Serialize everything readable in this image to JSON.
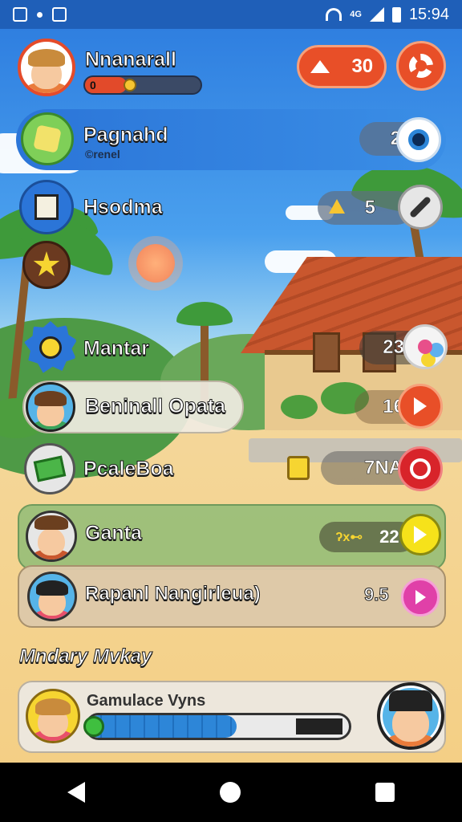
{
  "status_bar": {
    "time": "15:94",
    "network": "4G"
  },
  "player": {
    "name": "Nnanarall",
    "level_text": "0",
    "xp_fraction": 0.36
  },
  "coins": {
    "value": "30"
  },
  "rows": [
    {
      "label": "Pagnahd",
      "sub": "©renel",
      "value": "2"
    },
    {
      "label": "Hsodma",
      "value": "5"
    },
    {
      "label": "Mantar",
      "value": "23"
    },
    {
      "label": "Beninall Opata",
      "value": "16"
    },
    {
      "label": "PcaleBoa",
      "value": "7NA"
    },
    {
      "label": "Ganta",
      "value": "22",
      "prefix": "ʔx⊷"
    },
    {
      "label": "Rapanl Nangirleua)",
      "value": "9.5"
    }
  ],
  "section_title": "Mndary Mvkay",
  "bottom_card": {
    "title": "Gamulace Vyns",
    "progress_fraction": 0.57
  },
  "colors": {
    "accent": "#e84f28",
    "primary": "#2b75d8",
    "status_bar": "#1f5fb8"
  }
}
